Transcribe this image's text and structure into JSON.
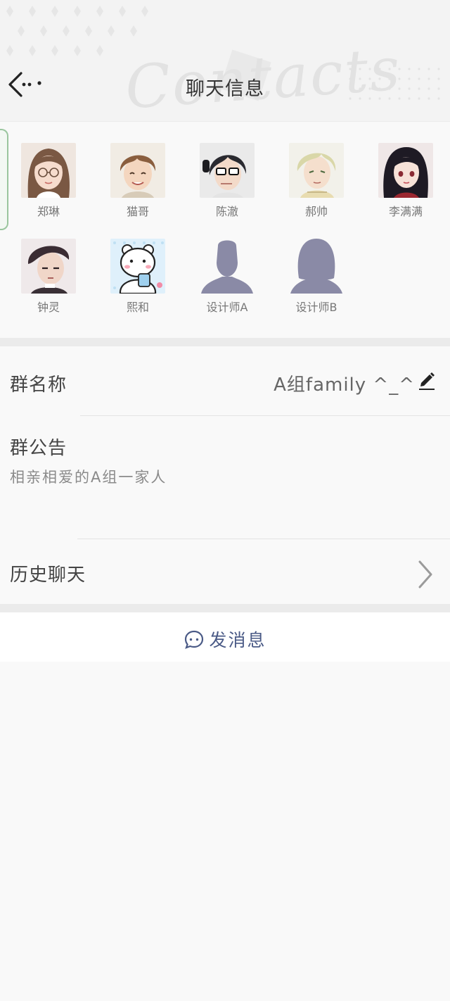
{
  "header": {
    "title": "聊天信息",
    "watermark": "Contacts"
  },
  "members": [
    {
      "name": "郑琳",
      "avatar": "girl-glasses-avatar"
    },
    {
      "name": "猫哥",
      "avatar": "brown-hair-boy-avatar"
    },
    {
      "name": "陈澈",
      "avatar": "headphones-boy-avatar"
    },
    {
      "name": "郝帅",
      "avatar": "blond-boy-avatar"
    },
    {
      "name": "李满满",
      "avatar": "black-hair-girl-avatar"
    },
    {
      "name": "钟灵",
      "avatar": "dark-hair-man-avatar"
    },
    {
      "name": "熙和",
      "avatar": "bear-sticker-avatar"
    },
    {
      "name": "设计师A",
      "avatar": "default-male-avatar"
    },
    {
      "name": "设计师B",
      "avatar": "default-female-avatar"
    }
  ],
  "group_name": {
    "label": "群名称",
    "value": "A组family ^_^"
  },
  "notice": {
    "label": "群公告",
    "text": "相亲相爱的A组一家人"
  },
  "history": {
    "label": "历史聊天"
  },
  "send": {
    "label": "发消息"
  },
  "colors": {
    "background": "#f9f9f9",
    "divider": "#ebebeb",
    "send_text": "#4a5a86",
    "placeholder_avatar": "#8a8aa6"
  }
}
